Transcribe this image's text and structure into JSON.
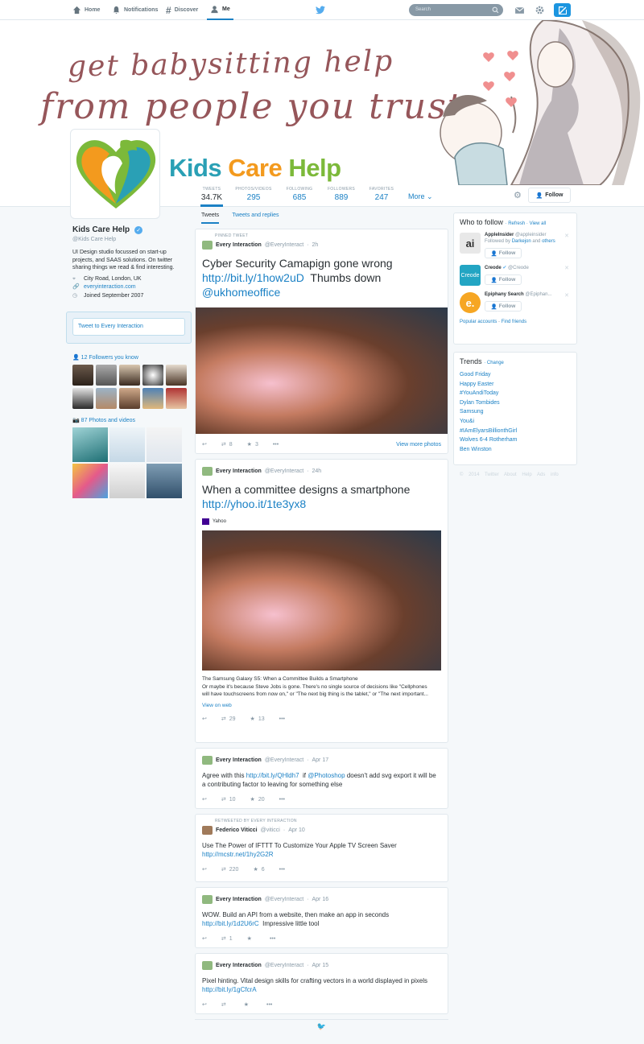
{
  "topbar": {
    "home": "Home",
    "notifications": "Notifications",
    "discover": "Discover",
    "me": "Me",
    "search_placeholder": "Search"
  },
  "banner": {
    "line1": "get babysitting help",
    "line2": "from people you trust",
    "brand_kids": "Kids ",
    "brand_care": "Care ",
    "brand_help": "Help"
  },
  "stats": [
    {
      "label": "Tweets",
      "value": "34.7K"
    },
    {
      "label": "Photos/Videos",
      "value": "295"
    },
    {
      "label": "Following",
      "value": "685"
    },
    {
      "label": "Followers",
      "value": "889"
    },
    {
      "label": "Favorites",
      "value": "247"
    }
  ],
  "more_label": "More",
  "follow_label": "Follow",
  "profile": {
    "name": "Kids Care Help",
    "handle": "@Kids Care Help",
    "bio": "UI Design studio focussed on start-up projects, and SAAS solutions. On twitter sharing things we read & find interesting.",
    "location": "City Road, London, UK",
    "website": "everyinteraction.com",
    "joined": "Joined September 2007",
    "tweet_to": "Tweet to Every Interaction",
    "followers_known": "12 Followers you know",
    "photos": "87 Photos and videos"
  },
  "tabs": {
    "tweets": "Tweets",
    "replies": "Tweets and replies"
  },
  "tweets": [
    {
      "label": "PINNED TWEET",
      "name": "Every Interaction",
      "handle": "@EveryInteract",
      "time": "2h",
      "text": "Cyber Security Camapign gone wrong",
      "link1": "http://bit.ly/1how2uD",
      "mid": "Thumbs down",
      "link2": "@ukhomeoffice",
      "retweets": "8",
      "favorites": "3",
      "view_more": "View more photos"
    },
    {
      "name": "Every Interaction",
      "handle": "@EveryInteract",
      "time": "24h",
      "text": "When a committee designs a smartphone",
      "link1": "http://yhoo.it/1te3yx8",
      "source": "Yahoo",
      "card_title": "The Samsung Galaxy S5: When a Committee Builds a Smartphone",
      "card_text": "Or maybe it's because Steve Jobs is gone. There's no single source of decisions like \"Cellphones will have touchscreens from now on,\" or \"The next big thing is the tablet,\" or \"The next important...",
      "view_web": "View on web",
      "retweets": "29",
      "favorites": "13"
    },
    {
      "name": "Every Interaction",
      "handle": "@EveryInteract",
      "time": "Apr 17",
      "pre": "Agree with this",
      "link1": "http://bit.ly/QHldh7",
      "mid": "if",
      "link2": "@Photoshop",
      "post": "doesn't add svg export it will be a contributing factor to leaving for something else",
      "retweets": "10",
      "favorites": "20"
    },
    {
      "label": "RETWEETED BY EVERY INTERACTION",
      "name": "Federico Viticci",
      "handle": "@viticci",
      "time": "Apr 10",
      "text": "Use The Power of IFTTT To Customize Your Apple TV Screen Saver",
      "link1": "http://mcstr.net/1hy2G2R",
      "retweets": "220",
      "favorites": "6"
    },
    {
      "name": "Every Interaction",
      "handle": "@EveryInteract",
      "time": "Apr 16",
      "text": "WOW. Build an API from a website, then make an app in seconds",
      "link1": "http://bit.ly/1d2U6rC",
      "post": "Impressive little tool",
      "retweets": "1",
      "favorites": ""
    },
    {
      "name": "Every Interaction",
      "handle": "@EveryInteract",
      "time": "Apr 15",
      "text": "Pixel hinting. Vital design skills for crafting vectors in a world displayed in pixels",
      "link1": "http://bit.ly/1gCfcrA",
      "retweets": "",
      "favorites": ""
    }
  ],
  "who_to_follow": {
    "title": "Who to follow",
    "refresh": "Refresh",
    "view_all": "View all",
    "accounts": [
      {
        "name": "AppleInsider",
        "handle": "@appleinsider",
        "note_pre": "Followed by",
        "note_a": "Darkejon",
        "note_mid": "and",
        "note_b": "others"
      },
      {
        "name": "Creode",
        "handle": "@Creode"
      },
      {
        "name": "Epiphany Search",
        "handle": "@Epiphan..."
      }
    ],
    "popular": "Popular accounts",
    "find": "Find friends"
  },
  "trends": {
    "title": "Trends",
    "change": "Change",
    "items": [
      "Good Friday",
      "Happy Easter",
      "#YouAndiToday",
      "Dylan Tombides",
      "Samsung",
      "You&i",
      "#IAmElyarsBillionthGirl",
      "Wolves 6-4 Rotherham",
      "Ben Winston"
    ]
  },
  "footer": "© 2014 Twitter About Help Ads info",
  "colors": {
    "accent": "#1b81c5",
    "brand_blue": "#2aa0b5",
    "brand_orange": "#f39a1e",
    "brand_green": "#7cb93a",
    "banner_text": "#96565a"
  }
}
